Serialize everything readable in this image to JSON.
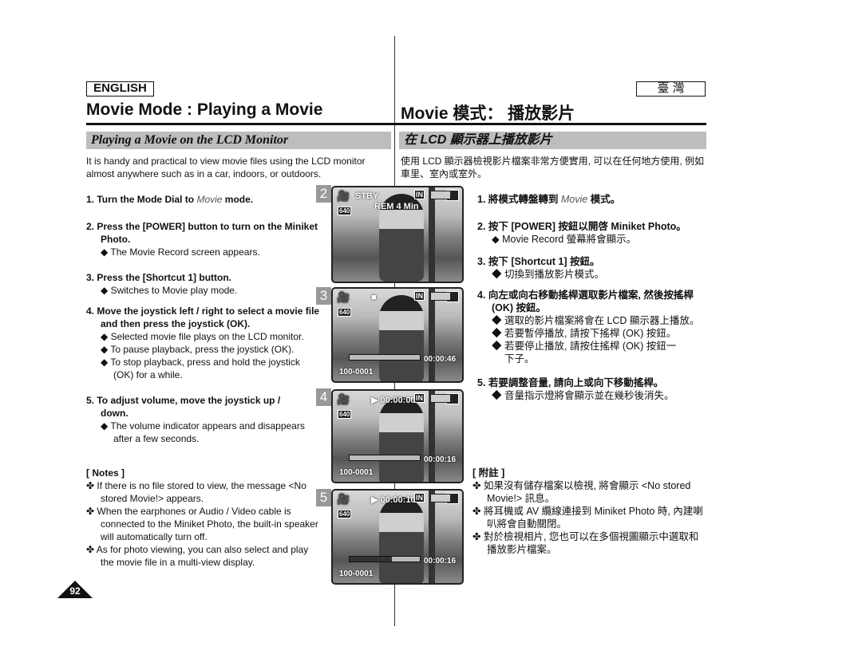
{
  "header": {
    "lang_en": "ENGLISH",
    "lang_tw": "臺 灣",
    "title_en": "Movie Mode : Playing a Movie",
    "title_tw": "Movie 模式： 播放影片"
  },
  "section": {
    "en": "Playing a Movie on the LCD Monitor",
    "tw": "在 LCD 顯示器上播放影片"
  },
  "intro": {
    "en": "It is handy and practical to view movie files using the LCD monitor almost anywhere such as in a car, indoors, or outdoors.",
    "tw": "使用 LCD 顯示器檢視影片檔案非常方便實用, 可以在任何地方使用, 例如車里、室內或室外。"
  },
  "steps_en": [
    {
      "pre": "1. Turn the Mode Dial to ",
      "em": "Movie",
      "post": " mode."
    },
    {
      "text": "2. Press the [POWER] button to turn on the Miniket Photo.",
      "sub": [
        "The Movie Record screen appears."
      ]
    },
    {
      "text": "3. Press the [Shortcut 1] button.",
      "sub": [
        "Switches to Movie play mode."
      ]
    },
    {
      "text": "4. Move the joystick left / right to select a movie file and then press the joystick (OK).",
      "sub": [
        "Selected movie file plays on the LCD monitor.",
        "To pause playback, press the joystick (OK).",
        "To stop playback, press and hold the joystick (OK) for a while."
      ]
    },
    {
      "text": "5. To adjust volume, move the joystick up / down.",
      "sub": [
        "The volume indicator appears and disappears after a few seconds."
      ]
    }
  ],
  "steps_tw": [
    {
      "pre": "1. 將模式轉盤轉到 ",
      "em": "Movie",
      "post": " 模式。"
    },
    {
      "text": "2. 按下 [POWER] 按鈕以開啓 Miniket Photo。",
      "sub": [
        "Movie Record 螢幕將會顯示。"
      ]
    },
    {
      "text": "3. 按下 [Shortcut 1] 按鈕。",
      "sub": [
        "切換到播放影片模式。"
      ]
    },
    {
      "text": "4. 向左或向右移動搖桿選取影片檔案, 然後按搖桿 (OK) 按鈕。",
      "sub": [
        "選取的影片檔案將會在 LCD 顯示器上播放。",
        "若要暫停播放, 請按下搖桿 (OK) 按鈕。",
        "若要停止播放, 請按住搖桿 (OK) 按鈕一下子。"
      ]
    },
    {
      "text": "5. 若要調整音量, 請向上或向下移動搖桿。",
      "sub": [
        "音量指示燈將會顯示並在幾秒後消失。"
      ]
    }
  ],
  "notes_en": {
    "title": "[ Notes ]",
    "items": [
      "If there is no file stored to view, the message <No stored Movie!> appears.",
      "When the earphones or Audio / Video cable is connected to the Miniket Photo, the built-in speaker will automatically turn off.",
      "As for photo viewing, you can also select and play the movie file in a multi-view display."
    ]
  },
  "notes_tw": {
    "title": "[ 附註 ]",
    "items": [
      "如果沒有儲存檔案以檢視, 將會顯示 <No stored Movie!> 訊息。",
      "將耳機或 AV 纜線連接到 Miniket Photo 時, 內建喇叭將會自動關閉。",
      "對於檢視相片, 您也可以在多個視圖顯示中選取和播放影片檔案。"
    ]
  },
  "screens": [
    {
      "num": "2",
      "status": "STBY",
      "rem": "REM 4 Min",
      "res": "640"
    },
    {
      "num": "3",
      "status": "■",
      "res": "640",
      "time": "00:00:46",
      "file": "100-0001",
      "progress": 0
    },
    {
      "num": "4",
      "status": "▶ 00:00:00",
      "res": "640",
      "time": "00:00:16",
      "file": "100-0001",
      "progress": 0
    },
    {
      "num": "5",
      "status": "▶ 00:00:10",
      "res": "640",
      "time": "00:00:16",
      "file": "100-0001",
      "progress": 60
    }
  ],
  "page_number": "92"
}
